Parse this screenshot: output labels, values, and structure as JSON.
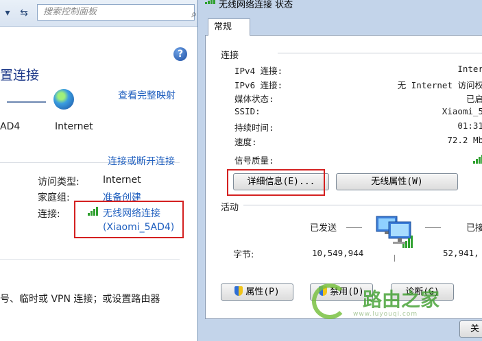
{
  "left": {
    "search": {
      "placeholder": "搜索控制面板"
    },
    "title": "置连接",
    "view_full_map": "查看完整映射",
    "network_name": "AD4",
    "internet_label": "Internet",
    "connect_disconnect": "连接或断开连接",
    "access_type": {
      "label": "访问类型:",
      "value": "Internet"
    },
    "homegroup": {
      "label": "家庭组:",
      "value": "准备创建"
    },
    "connections": {
      "label": "连接:",
      "value_line1": "无线网络连接",
      "value_line2": "(Xiaomi_5AD4)"
    },
    "bottom_text": "号、临时或 VPN 连接；或设置路由器"
  },
  "dialog": {
    "title": "无线网络连接 状态",
    "tab": "常规",
    "connection_section": "连接",
    "rows": [
      {
        "label": "IPv4 连接:",
        "value": "Inter"
      },
      {
        "label": "IPv6 连接:",
        "value": "无 Internet 访问权"
      },
      {
        "label": "媒体状态:",
        "value": "已启"
      },
      {
        "label": "SSID:",
        "value": "Xiaomi_5"
      },
      {
        "label": "持续时间:",
        "value": "01:31"
      },
      {
        "label": "速度:",
        "value": "72.2 Mb"
      }
    ],
    "signal_quality_label": "信号质量:",
    "details_button": "详细信息(E)...",
    "wireless_props_button": "无线属性(W)",
    "activity_section": "活动",
    "sent_label": "已发送",
    "received_label": "已接",
    "bytes_label": "字节:",
    "bytes_sent": "10,549,944",
    "bytes_received": "52,941,",
    "properties_button": "属性(P)",
    "disable_button": "禁用(D)",
    "diagnose_button": "诊断(G)",
    "close_button": "关"
  },
  "watermark": {
    "text": "路由之家",
    "sub": "www.luyouqi.com"
  },
  "colors": {
    "link": "#1f5fbf",
    "highlight_box": "#d42020",
    "signal": "#2fa02f",
    "dialog_frame": "#c3d4ea"
  }
}
